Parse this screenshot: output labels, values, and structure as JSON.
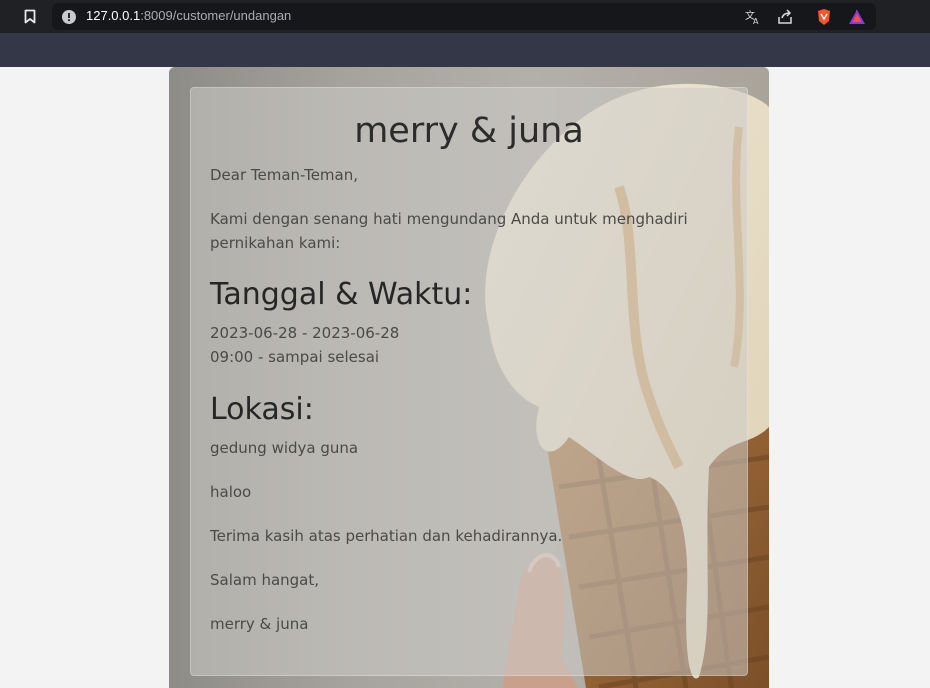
{
  "browser": {
    "url_host": "127.0.0.1",
    "url_path": ":8009/customer/undangan",
    "icons": [
      "bookmark-icon",
      "info-icon",
      "translate-icon",
      "share-icon",
      "brave-shield-icon",
      "brave-rewards-icon"
    ]
  },
  "invitation": {
    "title": "merry & juna",
    "greeting": "Dear Teman-Teman,",
    "intro_line1": "Kami dengan senang hati mengundang Anda untuk menghadiri",
    "intro_line2": "pernikahan kami:",
    "datetime_heading": "Tanggal & Waktu:",
    "date_range": "2023-06-28 - 2023-06-28",
    "time_range": "09:00 - sampai selesai",
    "location_heading": "Lokasi:",
    "location": "gedung widya guna",
    "note": "haloo",
    "thanks": "Terima kasih atas perhatian dan kehadirannya.",
    "closing": "Salam hangat,",
    "signature": "merry & juna"
  },
  "colors": {
    "chrome_dark": "#202124",
    "chrome_bar": "#333747",
    "page_bg": "#f3f3f3",
    "text": "#4a4a48",
    "heading": "#262626"
  }
}
